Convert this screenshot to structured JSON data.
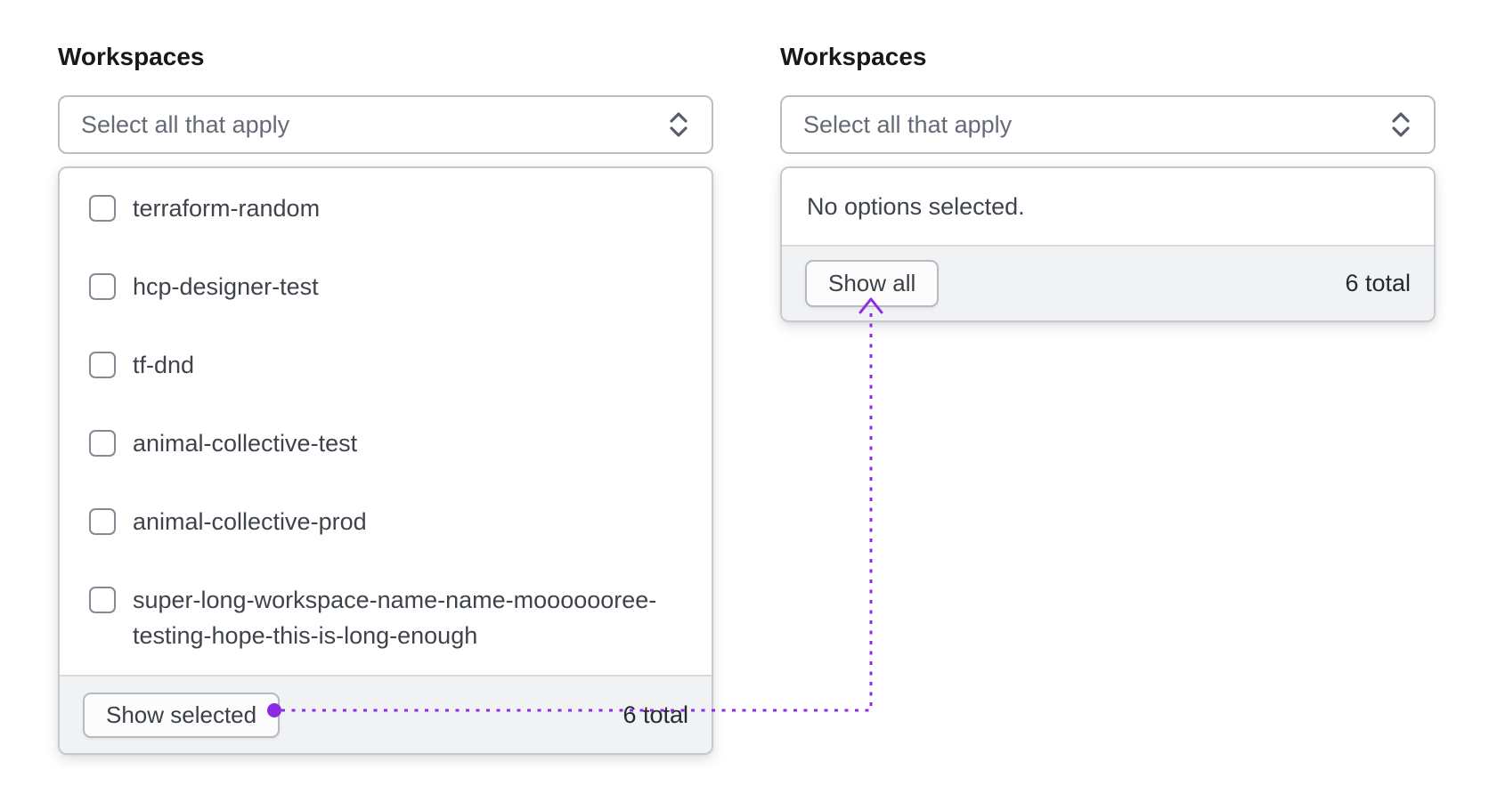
{
  "left": {
    "label": "Workspaces",
    "toggle_placeholder": "Select all that apply",
    "options": [
      "terraform-random",
      "hcp-designer-test",
      "tf-dnd",
      "animal-collective-test",
      "animal-collective-prod",
      "super-long-workspace-name-name-mooooooree-testing-hope-this-is-long-enough"
    ],
    "footer": {
      "button_label": "Show selected",
      "count_label": "6 total"
    }
  },
  "right": {
    "label": "Workspaces",
    "toggle_placeholder": "Select all that apply",
    "empty_message": "No options selected.",
    "footer": {
      "button_label": "Show all",
      "count_label": "6 total"
    }
  },
  "annotation": {
    "color": "#8c2ce2",
    "style": "dotted-arrow"
  }
}
